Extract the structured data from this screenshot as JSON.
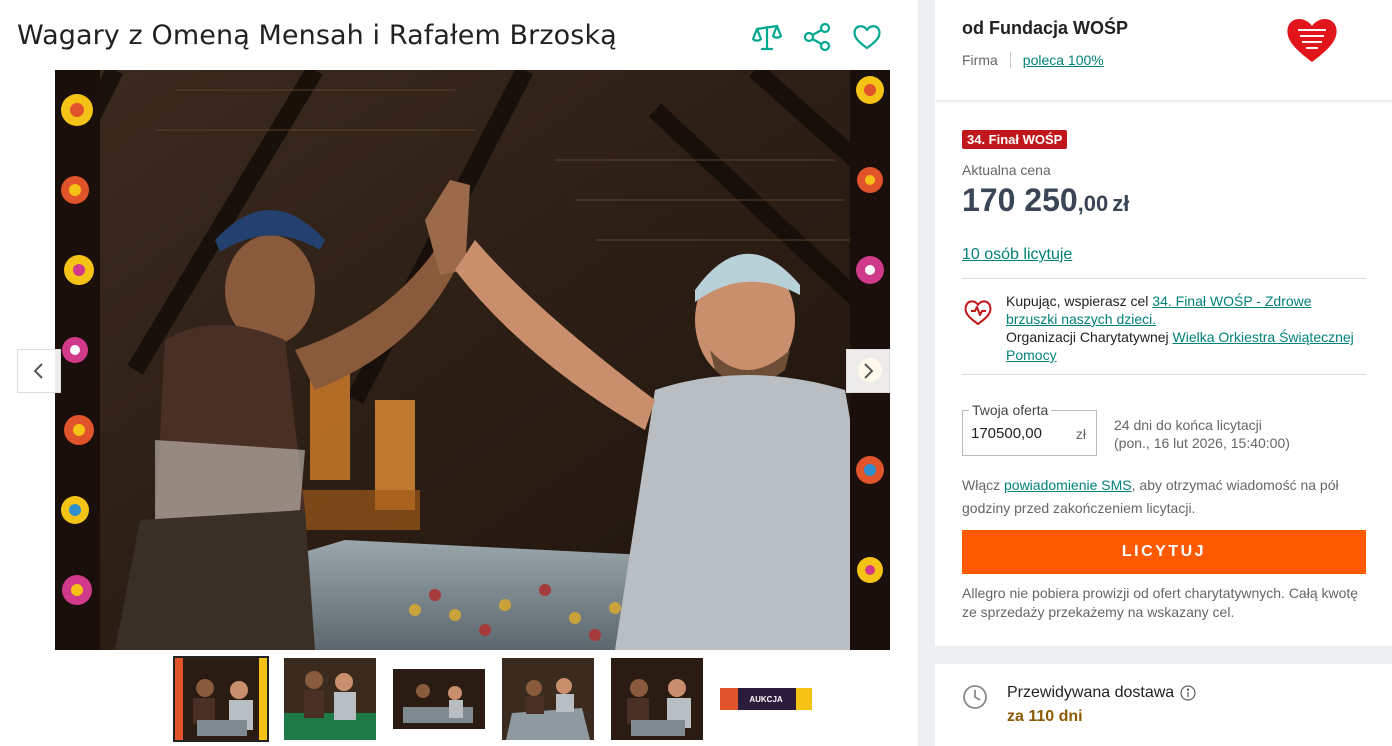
{
  "listing": {
    "title": "Wagary z Omeną Mensah i Rafałem Brzoską"
  },
  "icons": {
    "compare": "scales-icon",
    "share": "share-icon",
    "favorite": "heart-icon",
    "prev": "chevron-left-icon",
    "next": "chevron-right-icon",
    "charity": "heart-charity-icon",
    "delivery": "clock-icon",
    "info": "info-icon"
  },
  "thumbnails": [
    {
      "label": "zdjęcie 1"
    },
    {
      "label": "zdjęcie 2"
    },
    {
      "label": "zdjęcie 3"
    },
    {
      "label": "zdjęcie 4"
    },
    {
      "label": "zdjęcie 5"
    },
    {
      "label": "AUKCJA"
    }
  ],
  "seller": {
    "name": "od Fundacja WOŚP",
    "type": "Firma",
    "rating_link": "poleca 100%"
  },
  "auction": {
    "badge": "34. Finał WOŚP",
    "price_label": "Aktualna cena",
    "price_main": "170 250",
    "price_decimal": ",00",
    "currency": "zł",
    "bidders_link": "10 osób licytuje",
    "charity_prefix": "Kupując, wspierasz cel ",
    "charity_goal_link": "34. Finał WOŚP - Zdrowe brzuszki naszych dzieci.",
    "charity_org_prefix": "Organizacji Charytatywnej ",
    "charity_org_link": "Wielka Orkiestra Świątecznej Pomocy",
    "offer_legend": "Twoja oferta",
    "offer_value": "170500,00",
    "offer_currency": "zł",
    "ends_line1": "24 dni do końca licytacji",
    "ends_line2": "(pon., 16 lut 2026, 15:40:00)",
    "sms_prefix": "Włącz ",
    "sms_link": "powiadomienie SMS",
    "sms_suffix": ", aby otrzymać wiadomość na pół godziny przed zakończeniem licytacji.",
    "bid_button": "LICYTUJ",
    "fee_note": "Allegro nie pobiera prowizji od ofert charytatywnych. Całą kwotę ze sprzedaży przekażemy na wskazany cel."
  },
  "delivery": {
    "label": "Przewidywana dostawa",
    "value": "za 110 dni"
  },
  "colors": {
    "accent_teal": "#00827a",
    "bid_orange": "#ff5a00",
    "badge_red": "#c0171c",
    "price": "#3a4555",
    "delivery_brown": "#8c5a00"
  }
}
